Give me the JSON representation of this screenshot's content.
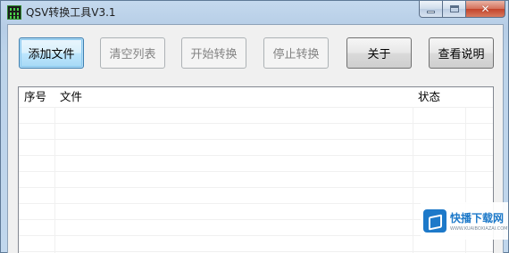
{
  "window": {
    "title": "QSV转换工具V3.1",
    "icon": "app-grid-icon",
    "controls": {
      "minimize_icon": "minimize-icon",
      "maximize_icon": "maximize-icon",
      "close_glyph": "✕"
    }
  },
  "toolbar": {
    "add_file": "添加文件",
    "clear_list": "清空列表",
    "start_convert": "开始转换",
    "stop_convert": "停止转换",
    "about": "关于",
    "view_help": "查看说明"
  },
  "file_list": {
    "columns": [
      "序号",
      "文件",
      "状态"
    ],
    "rows": []
  },
  "watermark": {
    "title": "快播下载网",
    "subtitle": "WWW.KUAIBOXIAZAI.COM"
  },
  "colors": {
    "title_bar": "#b9d1ea",
    "close_button": "#c3442b",
    "focus_border": "#3c7fb1",
    "disabled_text": "#838383",
    "watermark_accent": "#1d79c9"
  }
}
